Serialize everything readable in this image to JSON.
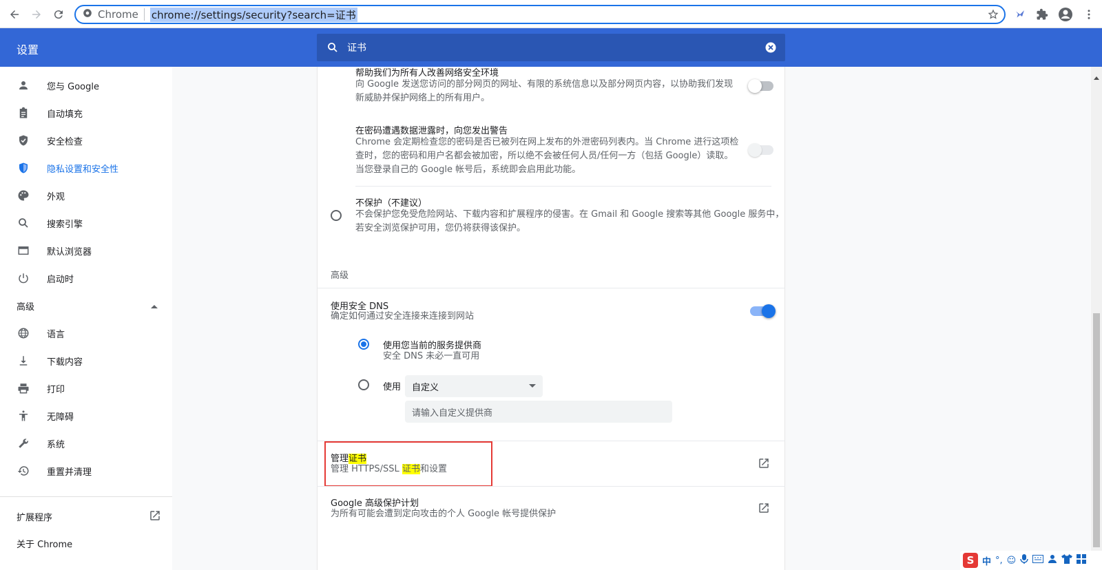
{
  "browser": {
    "site_name": "Chrome",
    "url": "chrome://settings/security?search=证书"
  },
  "header": {
    "title": "设置",
    "search_value": "证书"
  },
  "sidebar": {
    "items": [
      {
        "label": "您与 Google",
        "icon": "person-icon"
      },
      {
        "label": "自动填充",
        "icon": "clipboard-icon"
      },
      {
        "label": "安全检查",
        "icon": "shield-check-icon"
      },
      {
        "label": "隐私设置和安全性",
        "icon": "shield-icon"
      },
      {
        "label": "外观",
        "icon": "palette-icon"
      },
      {
        "label": "搜索引擎",
        "icon": "search-icon"
      },
      {
        "label": "默认浏览器",
        "icon": "browser-icon"
      },
      {
        "label": "启动时",
        "icon": "power-icon"
      }
    ],
    "advanced_label": "高级",
    "advanced_items": [
      {
        "label": "语言",
        "icon": "globe-icon"
      },
      {
        "label": "下载内容",
        "icon": "download-icon"
      },
      {
        "label": "打印",
        "icon": "printer-icon"
      },
      {
        "label": "无障碍",
        "icon": "accessibility-icon"
      },
      {
        "label": "系统",
        "icon": "wrench-icon"
      },
      {
        "label": "重置并清理",
        "icon": "history-icon"
      }
    ],
    "extensions_label": "扩展程序",
    "about_label": "关于 Chrome"
  },
  "main": {
    "help_improve": {
      "title": "帮助我们为所有人改善网络安全环境",
      "desc1": "向 Google 发送您访问的部分网页的网址、有限的系统信息以及部分网页内容，以协助我们发现",
      "desc2": "新威胁并保护网络上的所有用户。"
    },
    "password_warning": {
      "title": "在密码遭遇数据泄露时，向您发出警告",
      "desc1": "Chrome 会定期检查您的密码是否已被列在网上发布的外泄密码列表内。当 Chrome 进行这项检",
      "desc2": "查时，您的密码和用户名都会被加密，所以绝不会被任何人员/任何一方（包括 Google）读取。",
      "desc3": "当您登录自己的 Google 帐号后，系统即会启用此功能。"
    },
    "no_protection": {
      "title": "不保护（不建议）",
      "desc1": "不会保护您免受危险网站、下载内容和扩展程序的侵害。在 Gmail 和 Google 搜索等其他 Google 服务中，",
      "desc2": "若安全浏览保护可用，您仍将获得该保护。"
    },
    "advanced_heading": "高级",
    "secure_dns": {
      "title": "使用安全 DNS",
      "desc": "确定如何通过安全连接来连接到网站",
      "option1_title": "使用您当前的服务提供商",
      "option1_desc": "安全 DNS 未必一直可用",
      "option2_label": "使用",
      "select_value": "自定义",
      "custom_placeholder": "请输入自定义提供商"
    },
    "manage_certs": {
      "title_prefix": "管理",
      "title_highlight": "证书",
      "desc_prefix": "管理 HTTPS/SSL ",
      "desc_highlight": "证书",
      "desc_suffix": "和设置"
    },
    "advanced_protection": {
      "title": "Google 高级保护计划",
      "desc": "为所有可能会遭到定向攻击的个人 Google 帐号提供保护"
    }
  },
  "ime": {
    "logo": "S",
    "mode": "中"
  }
}
